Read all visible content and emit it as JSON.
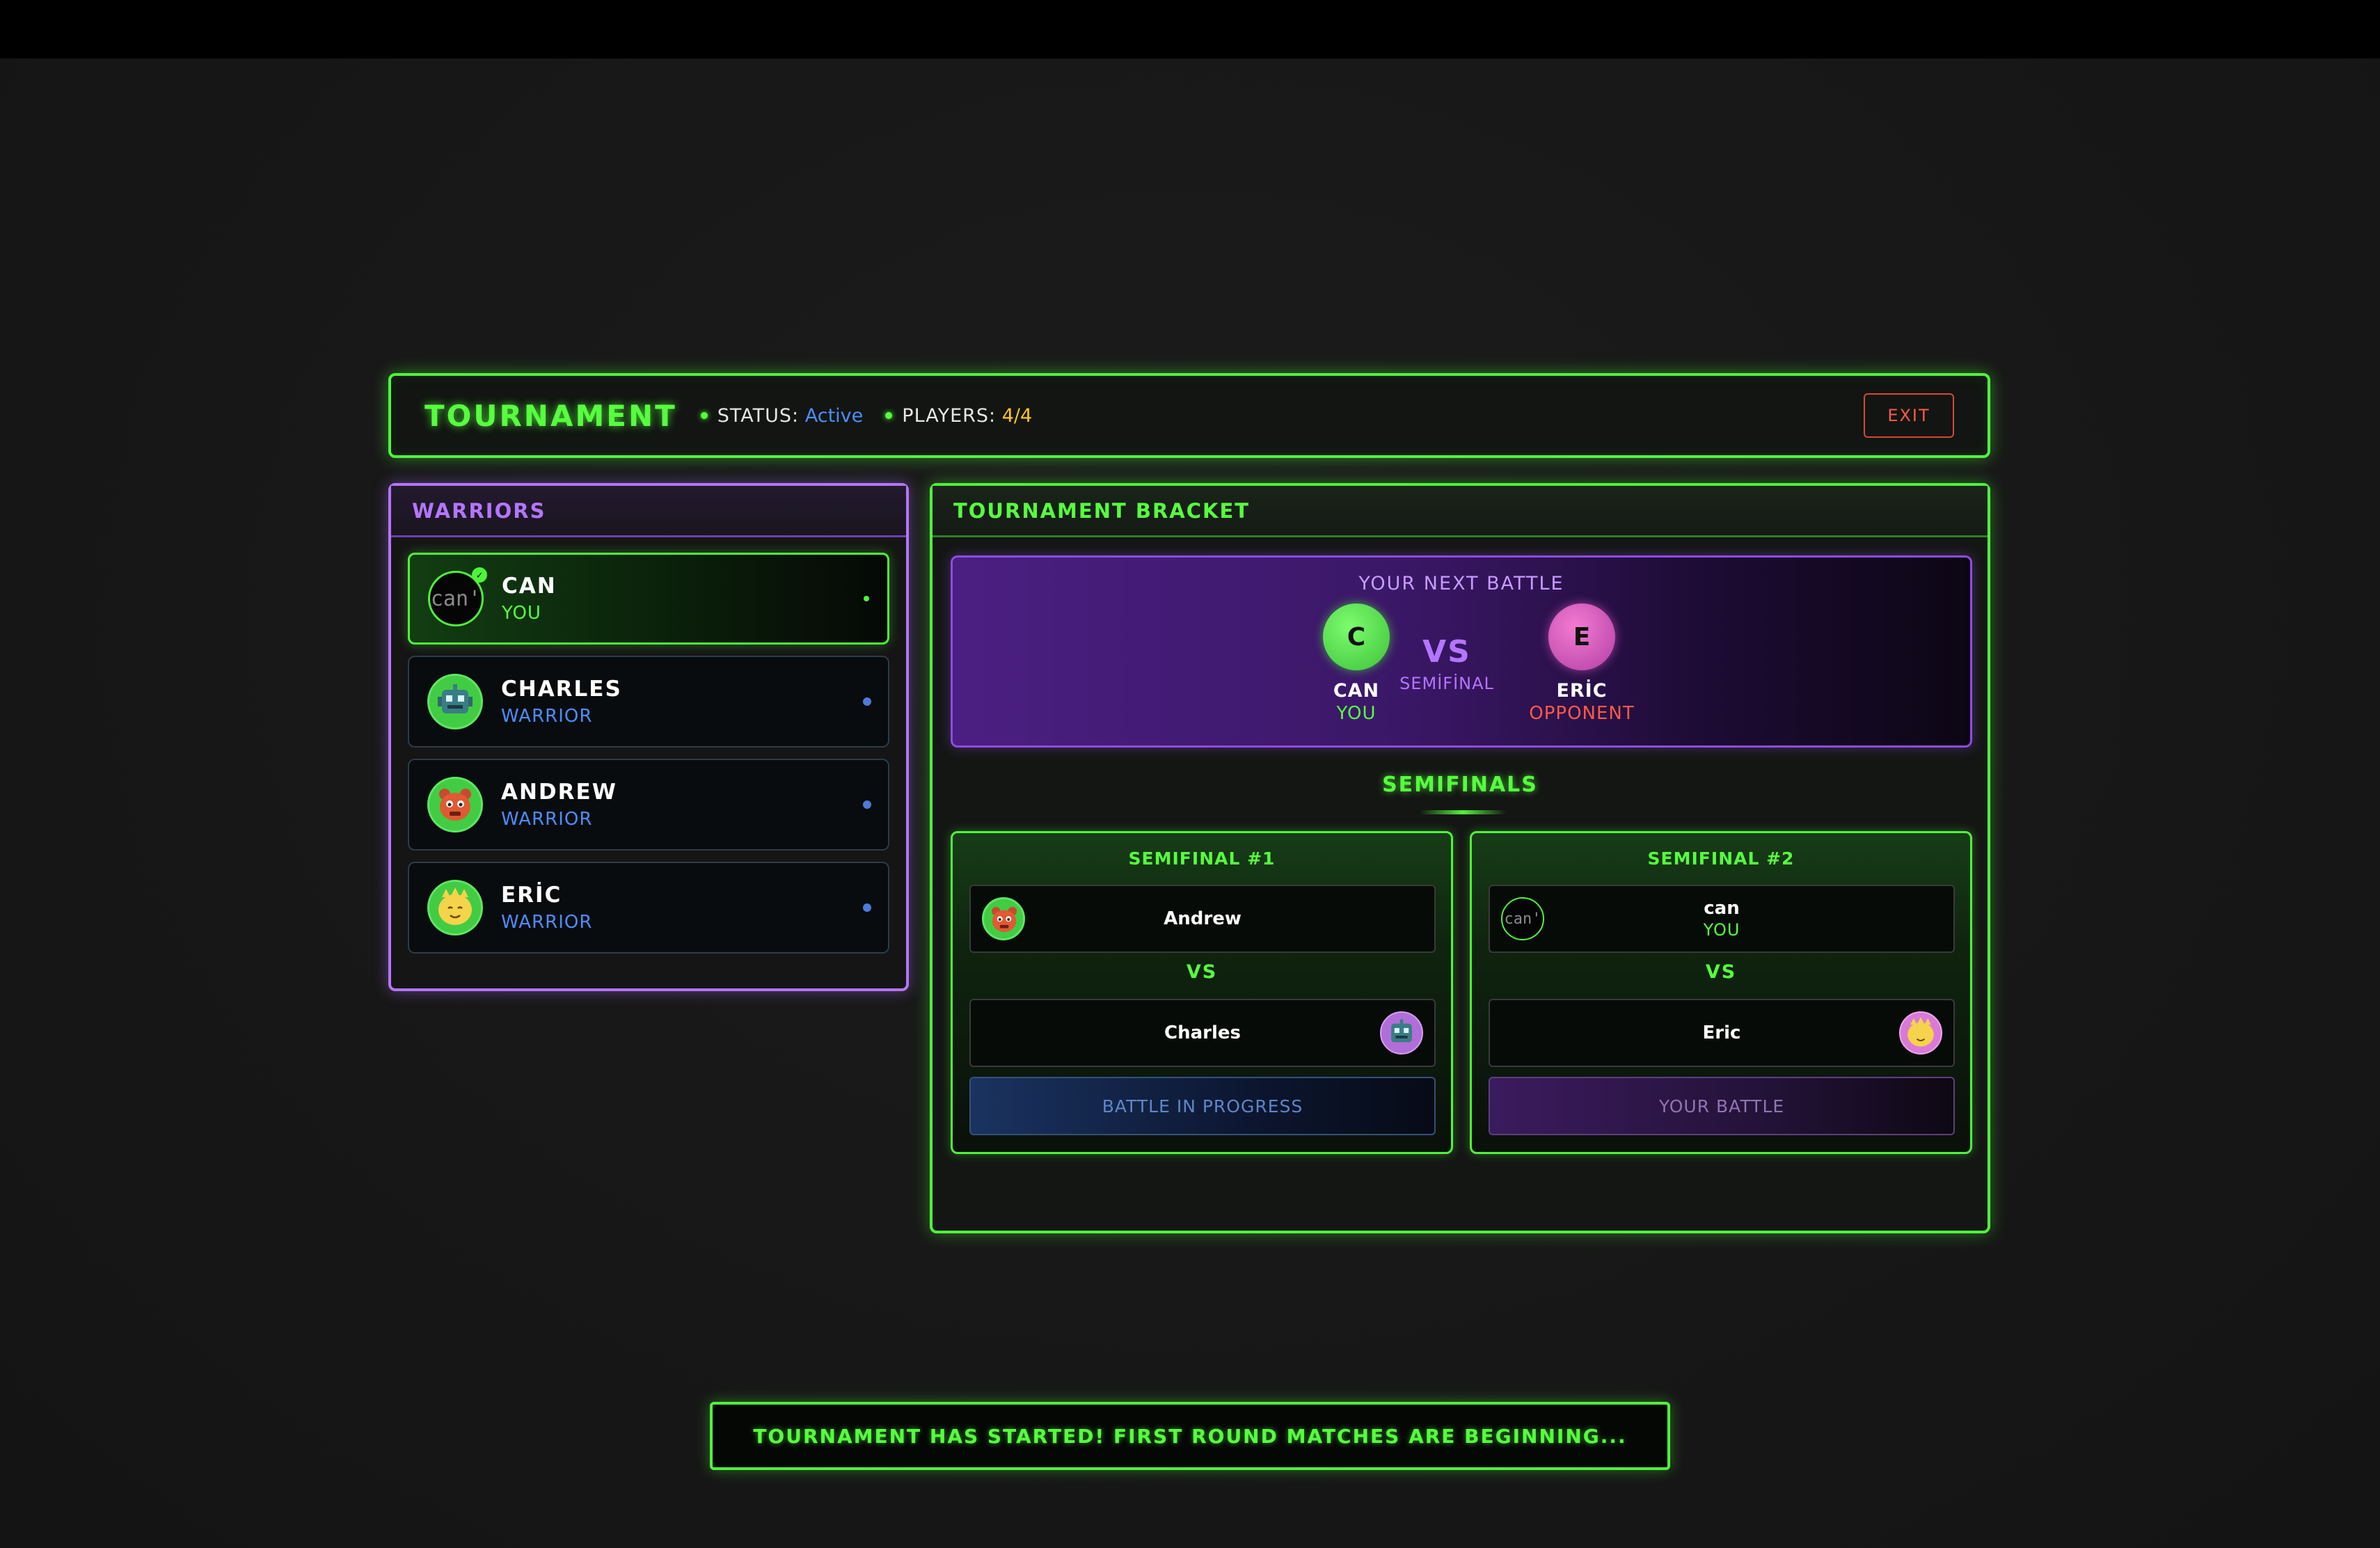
{
  "header": {
    "title": "TOURNAMENT",
    "status_label": "STATUS:",
    "status_value": "Active",
    "players_label": "PLAYERS:",
    "players_value": "4/4",
    "exit_label": "EXIT"
  },
  "warriors": {
    "title": "WARRIORS",
    "items": [
      {
        "name": "CAN",
        "role": "YOU",
        "avatar_text": "can'",
        "avatar": "self-placeholder-avatar"
      },
      {
        "name": "CHARLES",
        "role": "WARRIOR",
        "avatar": "robot-avatar"
      },
      {
        "name": "ANDREW",
        "role": "WARRIOR",
        "avatar": "red-creature-avatar"
      },
      {
        "name": "ERİC",
        "role": "WARRIOR",
        "avatar": "yellow-creature-avatar"
      }
    ]
  },
  "bracket": {
    "title": "TOURNAMENT BRACKET",
    "next_battle": {
      "title": "YOUR NEXT BATTLE",
      "player": {
        "initial": "C",
        "name": "CAN",
        "role": "YOU"
      },
      "vs": "VS",
      "round": "SEMİFİNAL",
      "opponent": {
        "initial": "E",
        "name": "ERİC",
        "role": "OPPONENT"
      }
    },
    "semis_title": "SEMIFINALS",
    "semifinals": [
      {
        "title": "SEMIFINAL #1",
        "top": {
          "name": "Andrew"
        },
        "vs": "VS",
        "bottom": {
          "name": "Charles"
        },
        "state": "BATTLE IN PROGRESS"
      },
      {
        "title": "SEMIFINAL #2",
        "top": {
          "name": "can",
          "sub": "YOU",
          "avatar_text": "can'"
        },
        "vs": "VS",
        "bottom": {
          "name": "Eric"
        },
        "state": "YOUR BATTLE"
      }
    ]
  },
  "toast": "TOURNAMENT HAS STARTED! FIRST ROUND MATCHES ARE BEGINNING...",
  "colors": {
    "accent_green": "#4ef53a",
    "accent_purple": "#b475ff",
    "status_blue": "#4c8dff",
    "players_yellow": "#ffc61c",
    "exit_red": "#ff5a46"
  }
}
